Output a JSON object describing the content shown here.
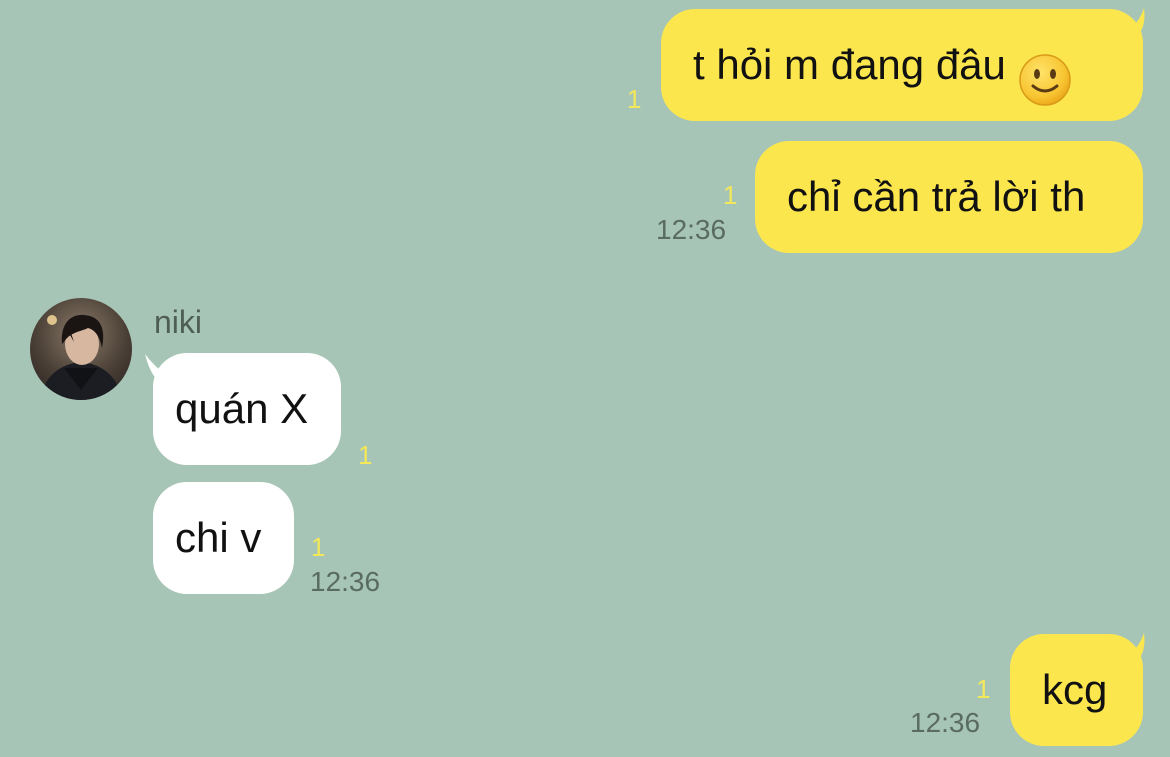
{
  "contact": {
    "name": "niki"
  },
  "messages": [
    {
      "direction": "outgoing",
      "text": "t hỏi m đang đâu",
      "emoji": "slightly-smiling-face",
      "unread": "1"
    },
    {
      "direction": "outgoing",
      "text": "chỉ cần trả lời th",
      "unread": "1",
      "time": "12:36"
    },
    {
      "direction": "incoming",
      "text": "quán X",
      "unread": "1"
    },
    {
      "direction": "incoming",
      "text": "chi v",
      "unread": "1",
      "time": "12:36"
    },
    {
      "direction": "outgoing",
      "text": "kcg",
      "unread": "1",
      "time": "12:36"
    }
  ],
  "colors": {
    "background": "#a7c5b6",
    "outgoing_bubble": "#fbe64e",
    "incoming_bubble": "#ffffff",
    "unread_count": "#f3e85a"
  }
}
